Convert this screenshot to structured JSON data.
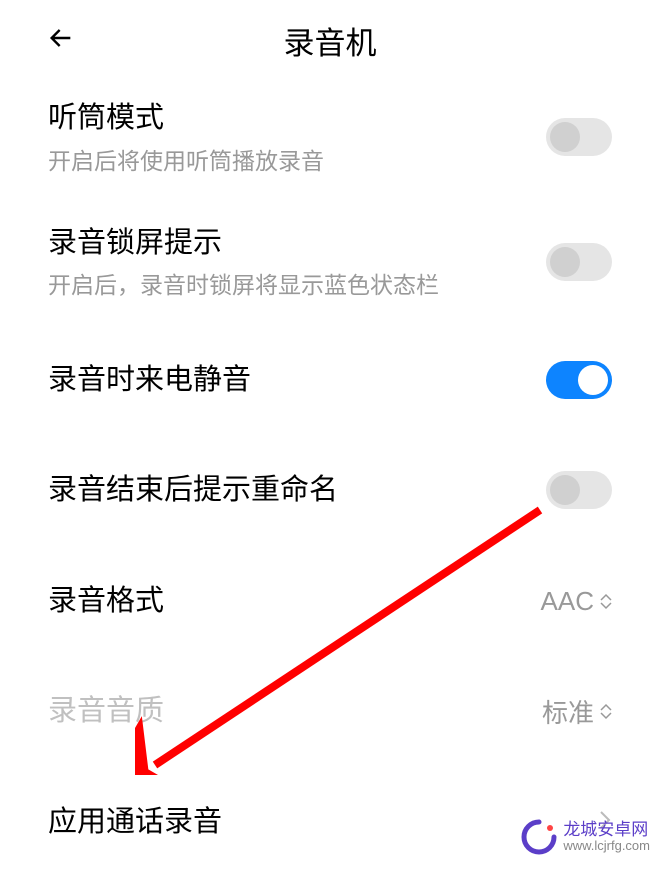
{
  "header": {
    "title": "录音机"
  },
  "settings": {
    "earpiece_mode": {
      "title": "听筒模式",
      "desc": "开启后将使用听筒播放录音",
      "enabled": false
    },
    "lock_screen_hint": {
      "title": "录音锁屏提示",
      "desc": "开启后，录音时锁屏将显示蓝色状态栏",
      "enabled": false
    },
    "mute_on_call": {
      "title": "录音时来电静音",
      "enabled": true
    },
    "rename_prompt": {
      "title": "录音结束后提示重命名",
      "enabled": false
    },
    "format": {
      "title": "录音格式",
      "value": "AAC"
    },
    "quality": {
      "title": "录音音质",
      "value": "标准"
    },
    "app_call_recording": {
      "title": "应用通话录音"
    }
  },
  "watermark": {
    "name": "龙城安卓网",
    "url": "www.lcjrfg.com"
  }
}
